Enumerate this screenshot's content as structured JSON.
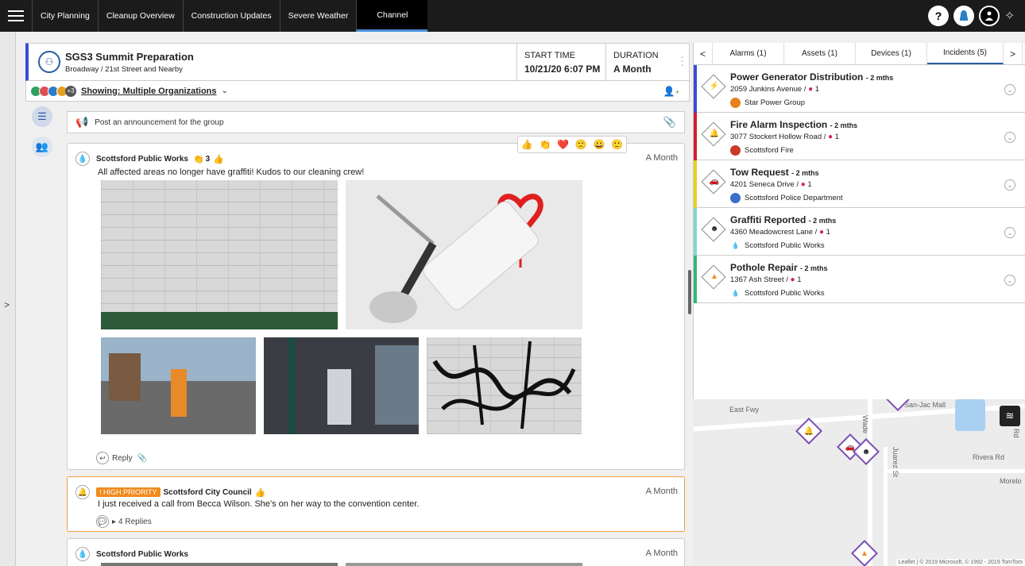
{
  "topbar": {
    "tabs": [
      {
        "label": "City Planning"
      },
      {
        "label": "Cleanup Overview"
      },
      {
        "label": "Construction Updates"
      },
      {
        "label": "Severe Weather"
      },
      {
        "label": "Channel"
      }
    ],
    "help_label": "?"
  },
  "channel": {
    "title": "SGS3 Summit Preparation",
    "location": "Broadway / 21st Street and Nearby",
    "start_time_label": "START TIME",
    "start_time_value": "10/21/20 6:07 PM",
    "duration_label": "DURATION",
    "duration_value": "A Month",
    "showing_label": "Showing: Multiple Organizations",
    "org_count": "+3"
  },
  "announce": {
    "placeholder": "Post an announcement for the group"
  },
  "posts": [
    {
      "author": "Scottsford Public Works",
      "clap_count": "3",
      "time": "A Month",
      "text": "All affected areas no longer have graffiti! Kudos to our cleaning crew!",
      "reply_label": "Reply"
    },
    {
      "priority": "! HIGH PRIORITY",
      "author": "Scottsford City Council",
      "time": "A Month",
      "text": "I just received a call from Becca Wilson. She's on her way to the convention center.",
      "replies_label": "4 Replies"
    },
    {
      "author": "Scottsford Public Works",
      "time": "A Month"
    }
  ],
  "right_tabs": [
    {
      "label": "Alarms (1)"
    },
    {
      "label": "Assets (1)"
    },
    {
      "label": "Devices (1)"
    },
    {
      "label": "Incidents (5)"
    }
  ],
  "incidents": [
    {
      "title": "Power Generator Distribution",
      "age": "- 2 mths",
      "address": "2059 Junkins Avenue /",
      "count": "1",
      "org": "Star Power Group",
      "color": "#3a4ecf"
    },
    {
      "title": "Fire Alarm Inspection",
      "age": "- 2 mths",
      "address": "3077 Stockert Hollow Road /",
      "count": "1",
      "org": "Scottsford Fire",
      "color": "#d02030"
    },
    {
      "title": "Tow Request",
      "age": "- 2 mths",
      "address": "4201 Seneca Drive /",
      "count": "1",
      "org": "Scottsford Police Department",
      "color": "#e8d020"
    },
    {
      "title": "Graffiti Reported",
      "age": "- 2 mths",
      "address": "4360 Meadowcrest Lane /",
      "count": "1",
      "org": "Scottsford Public Works",
      "color": "#7fd8d0"
    },
    {
      "title": "Pothole Repair",
      "age": "- 2 mths",
      "address": "1367 Ash Street /",
      "count": "1",
      "org": "Scottsford Public Works",
      "color": "#30b878"
    }
  ],
  "map": {
    "labels": {
      "east_fwy": "East Fwy",
      "mall": "San-Jac Mall",
      "wade": "Wade",
      "juarez": "Juarez St",
      "rivera": "Rivera Rd",
      "morelo": "Morelo",
      "rd": "k Rd"
    },
    "attribution": "Leaflet | © 2019 Microsoft, © 1992 - 2019 TomTom"
  }
}
